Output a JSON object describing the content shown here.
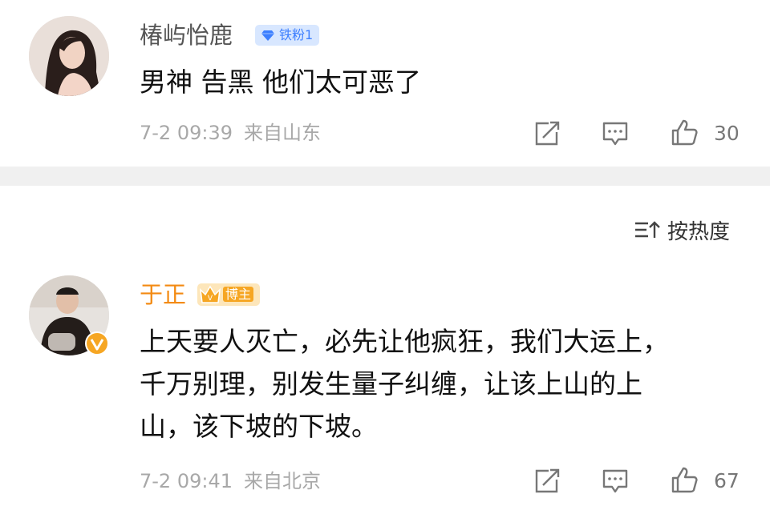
{
  "comments": [
    {
      "username": "椿屿怡鹿",
      "badge": "铁粉1",
      "text": "男神 告黑 他们太可恶了",
      "time": "7-2 09:39",
      "location": "来自山东",
      "likes": "30"
    },
    {
      "username": "于正",
      "badge": "博主",
      "text_lines": [
        "上天要人灭亡，必先让他疯狂，我们大运上，",
        "千万别理，别发生量子纠缠，让该上山的上",
        "山，该下坡的下坡。"
      ],
      "time": "7-2 09:41",
      "location": "来自北京",
      "likes": "67"
    }
  ],
  "sort": {
    "label": "按热度"
  },
  "colors": {
    "fan_badge_bg": "#d8e7ff",
    "fan_badge_text": "#3d7fff",
    "blogger_name": "#f38a12",
    "verified": "#f6a623",
    "separator": "#f0f0f0"
  },
  "icons": [
    "share-icon",
    "comment-icon",
    "like-icon",
    "sort-icon",
    "diamond-icon",
    "crown-icon",
    "verified-v-icon"
  ]
}
